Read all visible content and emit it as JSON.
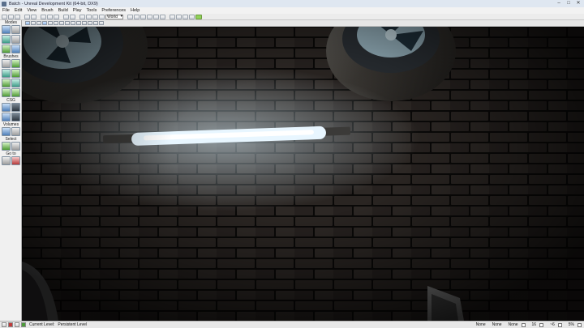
{
  "window": {
    "title": "Batch - Unreal Development Kit (64-bit, DX9)",
    "controls": [
      "–",
      "□",
      "✕"
    ]
  },
  "menu": [
    "File",
    "Edit",
    "View",
    "Brush",
    "Build",
    "Play",
    "Tools",
    "Preferences",
    "Help"
  ],
  "toolbar": {
    "coordinate_system": "World",
    "icons": [
      "new-icon",
      "open-icon",
      "save-icon",
      "undo-icon",
      "redo-icon",
      "cut-icon",
      "copy-icon",
      "paste-icon",
      "search-icon",
      "browser-icon",
      "select-icon",
      "move-icon",
      "rotate-icon",
      "scale-icon"
    ]
  },
  "modes_panel": {
    "title": "Modes",
    "sections": [
      {
        "label": "Brushes"
      },
      {
        "label": "CSG"
      },
      {
        "label": "Volumes"
      },
      {
        "label": "Select"
      },
      {
        "label": "Go to"
      }
    ]
  },
  "status_bar": {
    "current_level_label": "Current Level:",
    "current_level_value": "Persistent Level",
    "drag_grid_a": "None",
    "drag_grid_b": "None",
    "drag_grid_c": "None",
    "grid_size": "16",
    "rotation_snap": "~6",
    "scale_snap": "5%"
  },
  "colors": {
    "light_tube": "#e8f6ff",
    "brick": "#2a2522",
    "mortar": "#0a0908"
  }
}
